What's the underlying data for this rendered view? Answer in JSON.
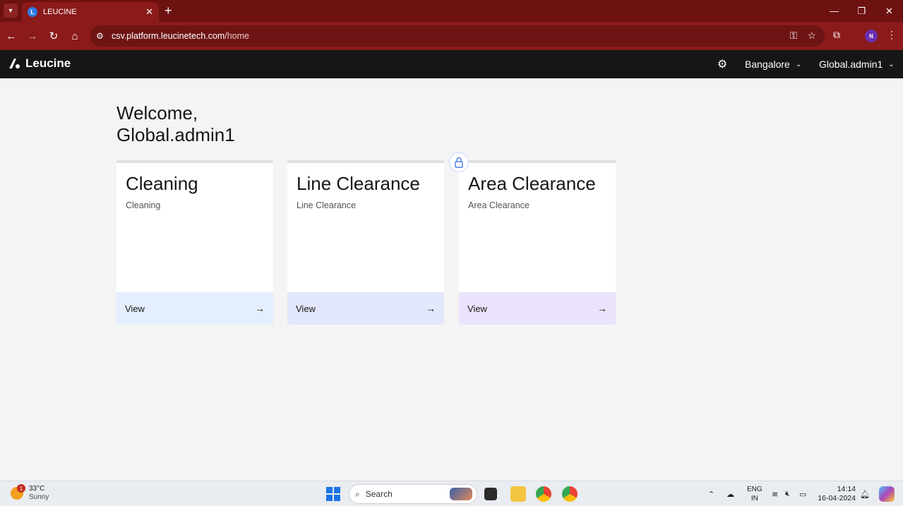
{
  "browser": {
    "tab_title": "LEUCINE",
    "tab_favicon": "L",
    "url_host": "csv.platform.leucinetech.com",
    "url_path": "/home",
    "profile_initial": "N"
  },
  "header": {
    "brand": "Leucine",
    "location": "Bangalore",
    "user": "Global.admin1"
  },
  "main": {
    "welcome_line1": "Welcome,",
    "welcome_line2": "Global.admin1",
    "cards": [
      {
        "title": "Cleaning",
        "subtitle": "Cleaning",
        "action": "View",
        "footer_color": "#e4eefd"
      },
      {
        "title": "Line Clearance",
        "subtitle": "Line Clearance",
        "action": "View",
        "footer_color": "#e3e7fb"
      },
      {
        "title": "Area Clearance",
        "subtitle": "Area Clearance",
        "action": "View",
        "footer_color": "#ebe3fb"
      }
    ]
  },
  "taskbar": {
    "weather_temp": "33°C",
    "weather_cond": "Sunny",
    "weather_badge": "1",
    "search_placeholder": "Search",
    "lang_line1": "ENG",
    "lang_line2": "IN",
    "time": "14:14",
    "date": "16-04-2024"
  },
  "colors": {
    "browser_frame": "#8b1a1a",
    "app_header": "#161616",
    "page_bg": "#f4f4f4"
  }
}
